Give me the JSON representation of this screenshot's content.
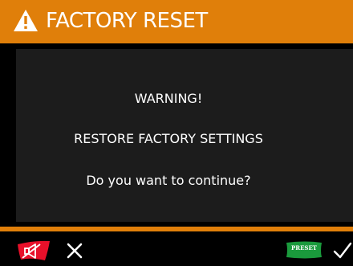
{
  "header": {
    "title": "FACTORY RESET",
    "icon": "warning-triangle-icon"
  },
  "dialog": {
    "line1": "WARNING!",
    "line2": "RESTORE FACTORY SETTINGS",
    "line3": "Do you want to continue?"
  },
  "footer": {
    "left_icons": [
      "mute-icon",
      "cancel-icon"
    ],
    "right_icons": [
      "preset-icon",
      "confirm-icon"
    ],
    "preset_label": "PRESET"
  },
  "colors": {
    "accent": "#e07f0a",
    "background": "#000000",
    "dialog": "#1c1c1c",
    "mute_icon": "#e8102a",
    "preset_icon": "#1a9a3c",
    "text": "#ffffff"
  }
}
